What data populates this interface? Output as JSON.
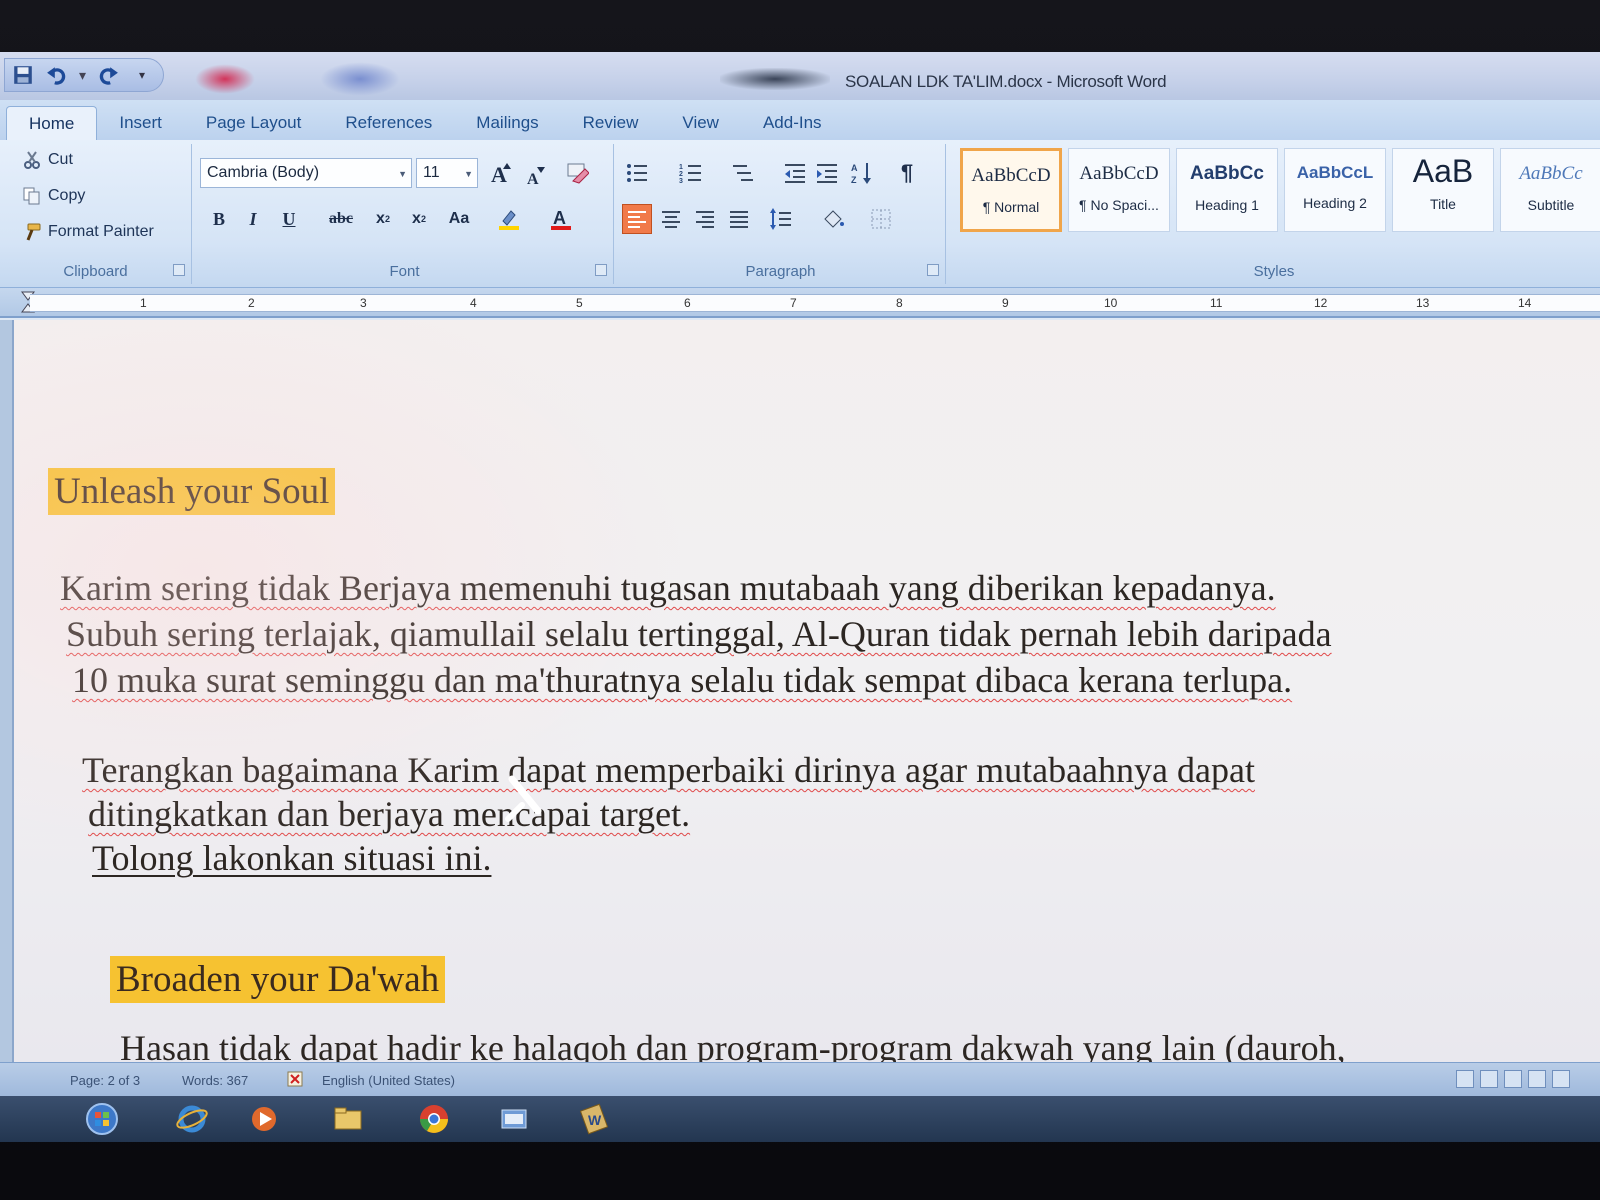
{
  "window": {
    "title": "SOALAN LDK TA'LIM.docx - Microsoft Word"
  },
  "tabs": [
    {
      "label": "Home",
      "active": true
    },
    {
      "label": "Insert"
    },
    {
      "label": "Page Layout"
    },
    {
      "label": "References"
    },
    {
      "label": "Mailings"
    },
    {
      "label": "Review"
    },
    {
      "label": "View"
    },
    {
      "label": "Add-Ins"
    }
  ],
  "ribbon": {
    "clipboard": {
      "label": "Clipboard",
      "cut": "Cut",
      "copy": "Copy",
      "format_painter": "Format Painter"
    },
    "font": {
      "label": "Font",
      "font_name": "Cambria (Body)",
      "font_size": "11"
    },
    "paragraph": {
      "label": "Paragraph"
    },
    "styles": {
      "label": "Styles",
      "items": [
        {
          "sample": "AaBbCcD",
          "name": "¶ Normal",
          "selected": true
        },
        {
          "sample": "AaBbCcD",
          "name": "¶ No Spaci..."
        },
        {
          "sample": "AaBbCc",
          "name": "Heading 1"
        },
        {
          "sample": "AaBbCcL",
          "name": "Heading 2"
        },
        {
          "sample": "AaB",
          "name": "Title"
        },
        {
          "sample": "AaBbCc",
          "name": "Subtitle"
        }
      ]
    }
  },
  "ruler": {
    "numbers": [
      "1",
      "2",
      "3",
      "4",
      "5",
      "6",
      "7",
      "8",
      "9",
      "10",
      "11",
      "12",
      "13",
      "14"
    ]
  },
  "document": {
    "heading1": "Unleash your Soul",
    "para1": [
      "Karim sering tidak  Berjaya memenuhi tugasan mutabaah yang diberikan kepadanya.",
      "Subuh sering terlajak, qiamullail selalu tertinggal, Al-Quran tidak pernah lebih daripada",
      "10  muka surat seminggu dan ma'thuratnya selalu tidak sempat dibaca kerana terlupa."
    ],
    "para2": [
      "Terangkan bagaimana Karim dapat memperbaiki dirinya  agar mutabaahnya dapat",
      "ditingkatkan dan berjaya mencapai target."
    ],
    "para2_instruction": "Tolong lakonkan situasi ini.",
    "heading2": "Broaden your Da'wah",
    "para3": "Hasan tidak dapat hadir ke halaqoh dan  program-program dakwah yang lain (dauroh,"
  },
  "status_bar": {
    "page": "Page: 2 of 3",
    "words": "Words: 367",
    "language": "English (United States)"
  },
  "colors": {
    "heading_highlight": "#f6c231",
    "selected_style_border": "#f0a54a",
    "spelling_squiggle": "#e04848"
  }
}
